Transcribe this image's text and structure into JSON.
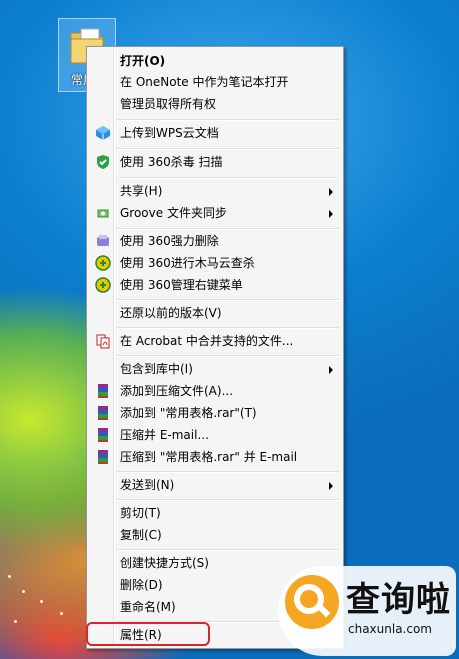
{
  "desktop_icon": {
    "label": "常用"
  },
  "menu": {
    "items": [
      {
        "label": "打开(O)",
        "bold": true,
        "icon": ""
      },
      {
        "label": "在 OneNote 中作为笔记本打开",
        "icon": ""
      },
      {
        "label": "管理员取得所有权",
        "icon": ""
      },
      {
        "label": "上传到WPS云文档",
        "icon": "wps-cloud-icon"
      },
      {
        "label": "使用 360杀毒 扫描",
        "icon": "360-antivirus-icon"
      },
      {
        "label": "共享(H)",
        "icon": "",
        "submenu": true
      },
      {
        "label": "Groove 文件夹同步",
        "icon": "groove-icon",
        "submenu": true
      },
      {
        "label": "使用 360强力删除",
        "icon": "360-shredder-icon"
      },
      {
        "label": "使用 360进行木马云查杀",
        "icon": "360-trojan-icon"
      },
      {
        "label": "使用 360管理右键菜单",
        "icon": "360-menu-manager-icon"
      },
      {
        "label": "还原以前的版本(V)",
        "icon": ""
      },
      {
        "label": "在 Acrobat 中合并支持的文件...",
        "icon": "acrobat-icon"
      },
      {
        "label": "包含到库中(I)",
        "icon": "",
        "submenu": true
      },
      {
        "label": "添加到压缩文件(A)...",
        "icon": "winrar-icon"
      },
      {
        "label": "添加到 \"常用表格.rar\"(T)",
        "icon": "winrar-icon"
      },
      {
        "label": "压缩并 E-mail...",
        "icon": "winrar-icon"
      },
      {
        "label": "压缩到 \"常用表格.rar\" 并 E-mail",
        "icon": "winrar-icon"
      },
      {
        "label": "发送到(N)",
        "icon": "",
        "submenu": true
      },
      {
        "label": "剪切(T)",
        "icon": ""
      },
      {
        "label": "复制(C)",
        "icon": ""
      },
      {
        "label": "创建快捷方式(S)",
        "icon": ""
      },
      {
        "label": "删除(D)",
        "icon": ""
      },
      {
        "label": "重命名(M)",
        "icon": ""
      },
      {
        "label": "属性(R)",
        "icon": "",
        "highlighted": true
      }
    ]
  },
  "watermark": {
    "title": "查询啦",
    "url": "chaxunla.com"
  },
  "colors": {
    "highlight": "#d9262d",
    "watermark_badge": "#f5a623"
  }
}
